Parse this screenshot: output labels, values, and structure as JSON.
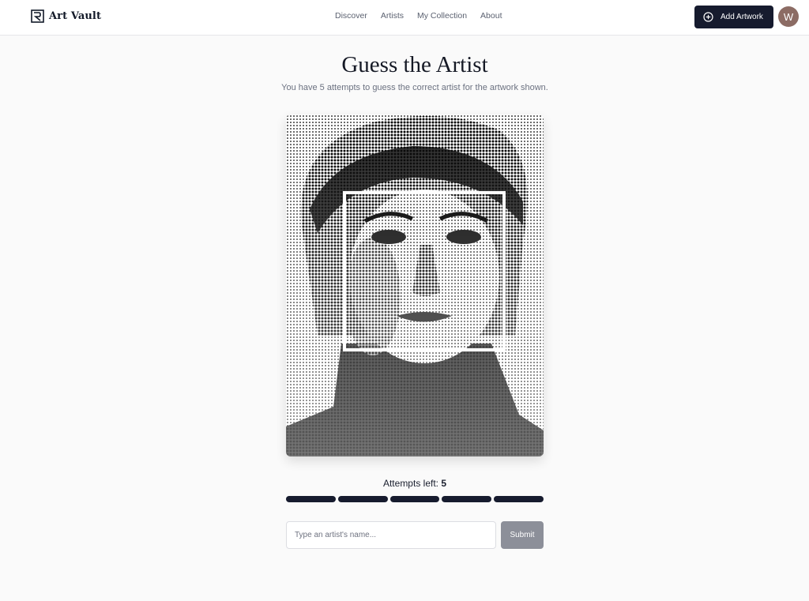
{
  "header": {
    "brand_name": "Art Vault",
    "nav": [
      "Discover",
      "Artists",
      "My Collection",
      "About"
    ],
    "add_button_label": "Add Artwork",
    "avatar_initial": "W"
  },
  "main": {
    "title": "Guess the Artist",
    "subtitle": "You have 5 attempts to guess the correct artist for the artwork shown.",
    "attempts_label": "Attempts left:",
    "attempts_left": "5",
    "attempts_total": 5,
    "guess_placeholder": "Type an artist's name...",
    "submit_label": "Submit"
  },
  "colors": {
    "primary": "#161b2e",
    "avatar": "#8c6c64",
    "submit_disabled": "#8c8f99"
  }
}
